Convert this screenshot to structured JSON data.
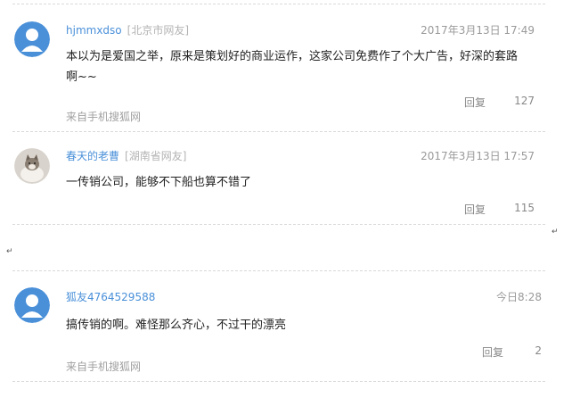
{
  "comments": [
    {
      "user": "hjmmxdso",
      "location": "[北京市网友]",
      "time": "2017年3月13日 17:49",
      "text_line1": "本以为是爱国之举，原来是策划好的商业运作，这家公司免费作了个大广告，好深的套路",
      "text_line2": "啊~~",
      "source": "来自手机搜狐网",
      "reply_label": "回复",
      "likes": "127",
      "avatar_icon": "default-avatar-icon"
    },
    {
      "user": "春天的老曹",
      "location": "[湖南省网友]",
      "time": "2017年3月13日 17:57",
      "text_line1": "一传销公司，能够不下船也算不错了",
      "reply_label": "回复",
      "likes": "115",
      "avatar_icon": "cat-photo-avatar"
    },
    {
      "user": "狐友4764529588",
      "time": "今日8:28",
      "text_line1": "搞传销的啊。难怪那么齐心，不过干的漂亮",
      "source": "来自手机搜狐网",
      "reply_label": "回复",
      "likes": "2",
      "avatar_icon": "default-avatar-icon"
    }
  ],
  "paragraph_mark": "↵",
  "colors": {
    "username": "#4a90d9",
    "location": "#b3b3b3",
    "avatar_blue": "#4a90d9",
    "divider": "#d9d9d9"
  }
}
